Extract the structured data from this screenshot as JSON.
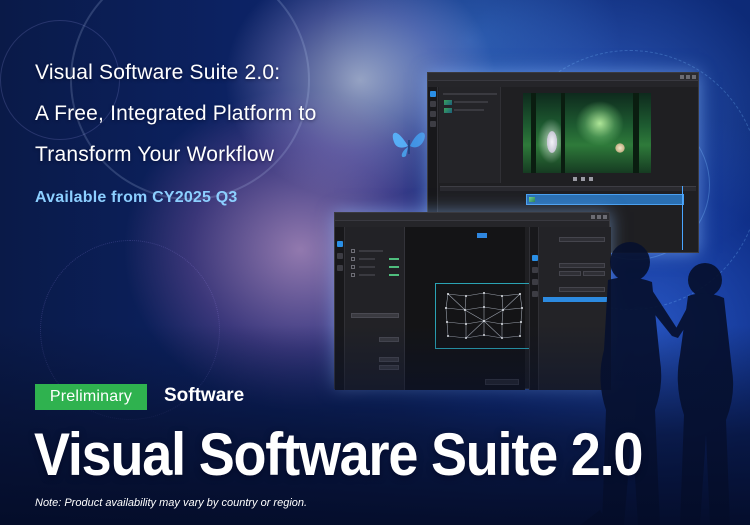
{
  "banner": {
    "headline_lines": [
      "Visual Software Suite 2.0:",
      "A Free, Integrated Platform to",
      "Transform Your Workflow"
    ],
    "availability": "Available from CY2025 Q3",
    "badge": "Preliminary",
    "category": "Software",
    "product_name": "Visual Software Suite 2.0",
    "note": "Note: Product availability may vary by country or region."
  },
  "colors": {
    "badge_bg": "#2fb24f",
    "availability_text": "#8ccfff",
    "accent_blue": "#2c8ae0"
  },
  "icons": [
    "butterfly-illustration",
    "silhouette-figures"
  ]
}
